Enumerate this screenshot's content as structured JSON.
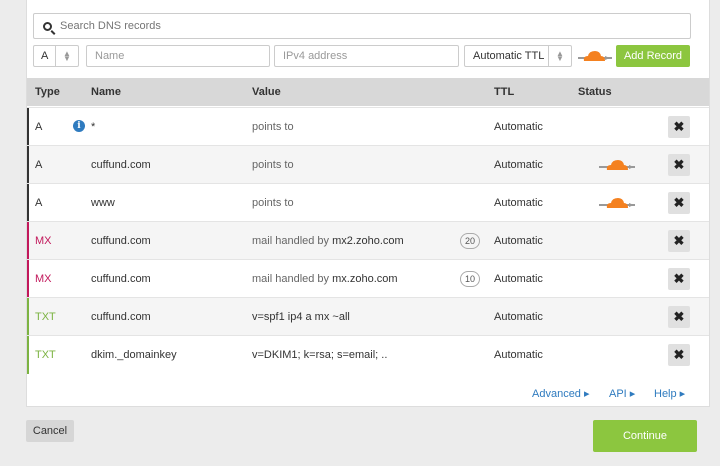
{
  "search": {
    "placeholder": "Search DNS records"
  },
  "add_form": {
    "type_value": "A",
    "name_placeholder": "Name",
    "ipv4_placeholder": "IPv4 address",
    "ttl_value": "Automatic TTL",
    "add_label": "Add Record"
  },
  "table": {
    "headers": {
      "type": "Type",
      "name": "Name",
      "value": "Value",
      "ttl": "TTL",
      "status": "Status"
    },
    "rows": [
      {
        "type": "A",
        "name": "*",
        "value_prefix": "points to",
        "value_main": "",
        "priority": "",
        "ttl": "Automatic",
        "proxied": false,
        "info": true
      },
      {
        "type": "A",
        "name": "cuffund.com",
        "value_prefix": "points to",
        "value_main": "",
        "priority": "",
        "ttl": "Automatic",
        "proxied": true,
        "info": false
      },
      {
        "type": "A",
        "name": "www",
        "value_prefix": "points to",
        "value_main": "",
        "priority": "",
        "ttl": "Automatic",
        "proxied": true,
        "info": false
      },
      {
        "type": "MX",
        "name": "cuffund.com",
        "value_prefix": "mail handled by",
        "value_main": "mx2.zoho.com",
        "priority": "20",
        "ttl": "Automatic",
        "proxied": false,
        "info": false
      },
      {
        "type": "MX",
        "name": "cuffund.com",
        "value_prefix": "mail handled by",
        "value_main": "mx.zoho.com",
        "priority": "10",
        "ttl": "Automatic",
        "proxied": false,
        "info": false
      },
      {
        "type": "TXT",
        "name": "cuffund.com",
        "value_prefix": "",
        "value_main": "v=spf1 ip4                    a mx ~all",
        "priority": "",
        "ttl": "Automatic",
        "proxied": false,
        "info": false
      },
      {
        "type": "TXT",
        "name": "dkim._domainkey",
        "value_prefix": "",
        "value_main": "v=DKIM1; k=rsa; s=email;                            ..",
        "priority": "",
        "ttl": "Automatic",
        "proxied": false,
        "info": false
      }
    ]
  },
  "type_colors": {
    "A": "#333333",
    "MX": "#c2185b",
    "TXT": "#7cb342"
  },
  "footer_links": {
    "advanced": "Advanced ▸",
    "api": "API ▸",
    "help": "Help ▸"
  },
  "buttons": {
    "cancel": "Cancel",
    "continue": "Continue"
  },
  "colors": {
    "accent": "#8cc63f",
    "link": "#2f7bbf",
    "cloud": "#f48120"
  }
}
